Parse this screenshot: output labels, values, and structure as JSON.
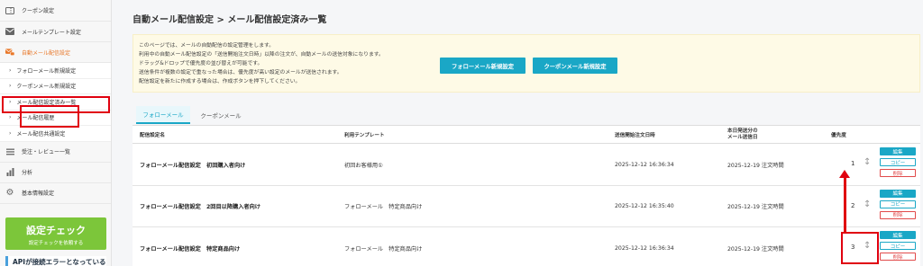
{
  "sidebar": {
    "items": [
      {
        "label": "クーポン設定",
        "icon": "ticket-icon"
      },
      {
        "label": "メールテンプレート設定",
        "icon": "mail-icon"
      },
      {
        "label": "自動メール配信設定",
        "icon": "send-mail-icon"
      },
      {
        "label": "受注・レビュー一覧",
        "icon": "list-icon"
      },
      {
        "label": "分析",
        "icon": "chart-icon"
      },
      {
        "label": "基本情報設定",
        "icon": "gear-icon"
      }
    ],
    "subitems": [
      "フォローメール新規設定",
      "クーポンメール新規設定",
      "メール配信設定済み一覧",
      "メール配信履歴",
      "メール配信共通設定"
    ],
    "check": {
      "title": "設定チェック",
      "subtitle": "設定チェックを依頼する"
    },
    "alert": "APIが接続エラーとなっている"
  },
  "page": {
    "title": "自動メール配信設定 > メール配信設定済み一覧"
  },
  "info": {
    "lines": [
      "このページでは、メールの自動配信の設定管理をします。",
      "利用中の自動メール配信設定の「送信開始注文日時」以降の注文が、自動メールの送信対象になります。",
      "ドラッグ&ドロップで優先度の並び替えが可能です。",
      "送信条件が複数の設定で重なった場合は、優先度が高い設定のメールが送信されます。",
      "配信設定を新たに作成する場合は、作成ボタンを押下してください。"
    ],
    "btn_follow": "フォローメール新規設定",
    "btn_coupon": "クーポンメール新規設定"
  },
  "tabs": {
    "active": "フォローメール",
    "other": "クーポンメール"
  },
  "table": {
    "headers": {
      "name": "配信設定名",
      "template": "利用テンプレート",
      "start": "送信開始注文日時",
      "today_line1": "本日発送分の",
      "today_line2": "メール送信日",
      "priority": "優先度"
    },
    "rows": [
      {
        "name": "フォローメール配信設定　初回購入者向け",
        "template": "初回お客様用①",
        "start": "2025-12-12 16:36:34",
        "today": "2025-12-19 注文時間",
        "priority": "1"
      },
      {
        "name": "フォローメール配信設定　2回目以降購入者向け",
        "template": "フォローメール　特定商品向け",
        "start": "2025-12-12 16:35:40",
        "today": "2025-12-19 注文時間",
        "priority": "2"
      },
      {
        "name": "フォローメール配信設定　特定商品向け",
        "template": "フォローメール　特定商品向け",
        "start": "2025-12-12 16:36:34",
        "today": "2025-12-19 注文時間",
        "priority": "3"
      }
    ],
    "actions": {
      "edit": "編集",
      "copy": "コピー",
      "delete": "削除"
    }
  },
  "colors": {
    "accent": "#1aa7c6",
    "active_nav": "#e8782a",
    "annotation": "#e0000f",
    "check": "#7cc63a"
  }
}
